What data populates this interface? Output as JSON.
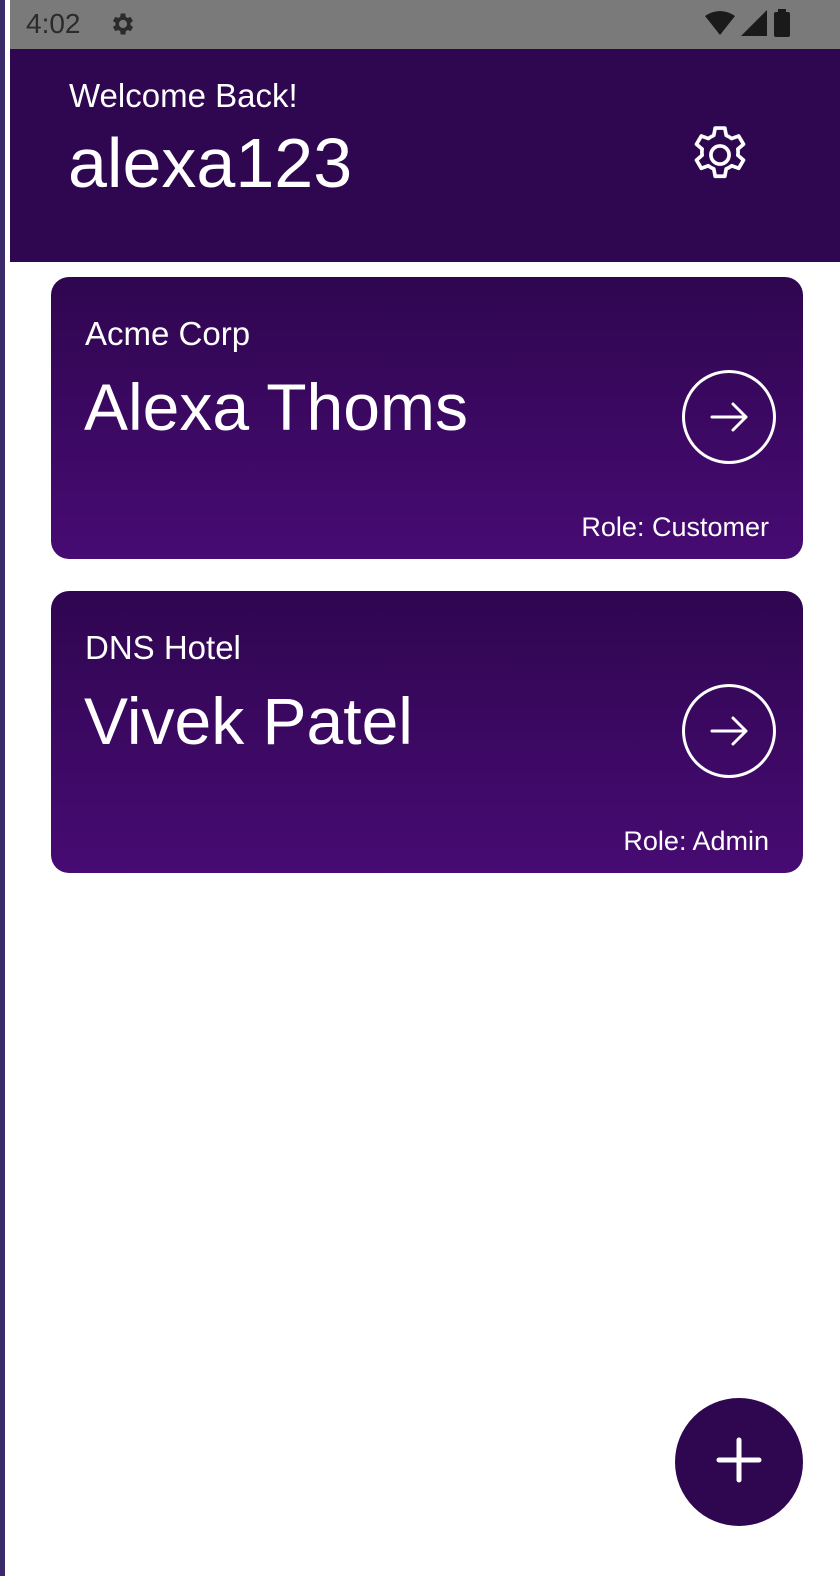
{
  "status_bar": {
    "time": "4:02",
    "icons": [
      "settings-icon",
      "wifi-icon",
      "signal-icon",
      "battery-icon"
    ]
  },
  "header": {
    "greeting": "Welcome Back!",
    "username": "alexa123",
    "settings_icon": "gear-icon",
    "background": "#2f0650"
  },
  "accounts": [
    {
      "company": "Acme Corp",
      "name": "Alexa Thoms",
      "role": "Role: Customer",
      "action_icon": "arrow-right-circle-icon"
    },
    {
      "company": "DNS Hotel",
      "name": "Vivek Patel",
      "role": "Role: Admin",
      "action_icon": "arrow-right-circle-icon"
    }
  ],
  "fab": {
    "icon": "plus-icon"
  },
  "colors": {
    "primary": "#2f0650",
    "card_gradient_end": "#470b73",
    "text_on_primary": "#ffffff",
    "status_bar": "#7a7a7a"
  }
}
